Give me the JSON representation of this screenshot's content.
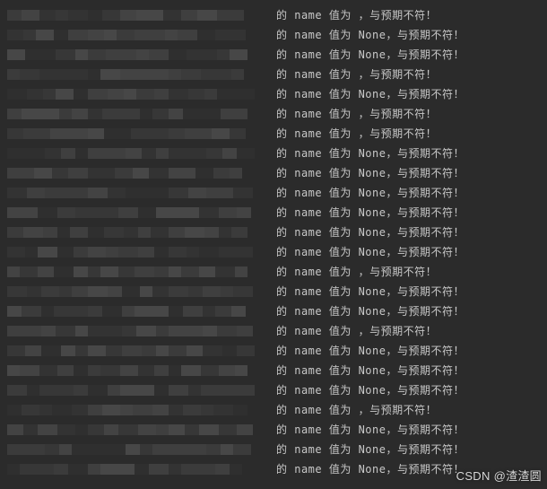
{
  "console": {
    "lines": [
      {
        "redacted_pattern": [
          38,
          42,
          40,
          36,
          44,
          38,
          42,
          40,
          36,
          38,
          42,
          40,
          44,
          36,
          38
        ],
        "field": "name",
        "value": "",
        "suffix_lang": "cn"
      },
      {
        "redacted_pattern": [
          40,
          36,
          42,
          38,
          44,
          40,
          36,
          42,
          38,
          40,
          36,
          44,
          42,
          38,
          40
        ],
        "field": "name",
        "value": "None",
        "suffix_lang": "cn"
      },
      {
        "redacted_pattern": [
          42,
          38,
          40,
          44,
          36,
          42,
          38,
          40,
          36,
          44,
          42,
          38,
          40,
          36,
          42
        ],
        "field": "name",
        "value": "None",
        "suffix_lang": "cn"
      },
      {
        "redacted_pattern": [
          36,
          44,
          38,
          40,
          42,
          36,
          44,
          38,
          40,
          42,
          36,
          44,
          38,
          40,
          36
        ],
        "field": "name",
        "value": "",
        "suffix_lang": "cn"
      },
      {
        "redacted_pattern": [
          44,
          40,
          36,
          42,
          38,
          44,
          40,
          36,
          42,
          38,
          44,
          40,
          36,
          42,
          44
        ],
        "field": "name",
        "value": "None",
        "suffix_lang": "cn"
      },
      {
        "redacted_pattern": [
          38,
          42,
          44,
          36,
          40,
          38,
          42,
          44,
          36,
          40,
          38,
          42,
          44,
          36,
          38
        ],
        "field": "name",
        "value": "",
        "suffix_lang": "cn"
      },
      {
        "redacted_pattern": [
          40,
          36,
          38,
          42,
          44,
          40,
          36,
          38,
          42,
          44,
          40,
          36,
          38,
          42,
          40
        ],
        "field": "name",
        "value": "",
        "suffix_lang": "cn"
      },
      {
        "redacted_pattern": [
          42,
          44,
          40,
          38,
          36,
          42,
          44,
          40,
          38,
          36,
          42,
          44,
          40,
          38,
          42
        ],
        "field": "name",
        "value": "None",
        "suffix_lang": "cn"
      },
      {
        "redacted_pattern": [
          36,
          38,
          42,
          40,
          44,
          36,
          38,
          42,
          40,
          44,
          36,
          38,
          42,
          40,
          36
        ],
        "field": "name",
        "value": "None",
        "suffix_lang": "cn"
      },
      {
        "redacted_pattern": [
          44,
          42,
          36,
          38,
          40,
          44,
          42,
          36,
          38,
          40,
          44,
          42,
          36,
          38,
          44
        ],
        "field": "name",
        "value": "None",
        "suffix_lang": "cn"
      },
      {
        "redacted_pattern": [
          38,
          40,
          44,
          42,
          36,
          38,
          40,
          44,
          42,
          36,
          38,
          40,
          44,
          42,
          38
        ],
        "field": "name",
        "value": "None",
        "suffix_lang": "cn"
      },
      {
        "redacted_pattern": [
          40,
          44,
          38,
          36,
          42,
          40,
          44,
          38,
          36,
          42,
          40,
          44,
          38,
          36,
          40
        ],
        "field": "name",
        "value": "None",
        "suffix_lang": "cn"
      },
      {
        "redacted_pattern": [
          42,
          36,
          44,
          40,
          38,
          42,
          36,
          44,
          40,
          38,
          42,
          36,
          44,
          40,
          42
        ],
        "field": "name",
        "value": "None",
        "suffix_lang": "cn"
      },
      {
        "redacted_pattern": [
          36,
          42,
          40,
          44,
          38,
          36,
          42,
          40,
          44,
          38,
          36,
          42,
          40,
          44,
          36
        ],
        "field": "name",
        "value": "",
        "suffix_lang": "cn"
      },
      {
        "redacted_pattern": [
          44,
          38,
          42,
          36,
          40,
          44,
          38,
          42,
          36,
          40,
          44,
          38,
          42,
          36,
          44
        ],
        "field": "name",
        "value": "None",
        "suffix_lang": "cn"
      },
      {
        "redacted_pattern": [
          38,
          44,
          36,
          40,
          42,
          38,
          44,
          36,
          40,
          42,
          38,
          44,
          36,
          40,
          38
        ],
        "field": "name",
        "value": "None",
        "suffix_lang": "cn"
      },
      {
        "redacted_pattern": [
          40,
          42,
          38,
          44,
          36,
          40,
          42,
          38,
          44,
          36,
          40,
          42,
          38,
          44,
          40
        ],
        "field": "name",
        "value": "",
        "suffix_lang": "cn"
      },
      {
        "redacted_pattern": [
          42,
          40,
          44,
          38,
          36,
          42,
          40,
          44,
          38,
          36,
          42,
          40,
          44,
          38,
          42
        ],
        "field": "name",
        "value": "None",
        "suffix_lang": "cn"
      },
      {
        "redacted_pattern": [
          36,
          44,
          42,
          40,
          38,
          36,
          44,
          42,
          40,
          38,
          36,
          44,
          42,
          40,
          36
        ],
        "field": "name",
        "value": "None",
        "suffix_lang": "cn"
      },
      {
        "redacted_pattern": [
          44,
          36,
          40,
          42,
          38,
          44,
          36,
          40,
          42,
          38,
          44,
          36,
          40,
          42,
          44
        ],
        "field": "name",
        "value": "None",
        "suffix_lang": "cn"
      },
      {
        "redacted_pattern": [
          38,
          42,
          36,
          44,
          40,
          38,
          42,
          36,
          44,
          40,
          38,
          42,
          36,
          44,
          38
        ],
        "field": "name",
        "value": "",
        "suffix_lang": "cn"
      },
      {
        "redacted_pattern": [
          40,
          38,
          44,
          42,
          36,
          40,
          38,
          44,
          42,
          36,
          40,
          38,
          44,
          42,
          40
        ],
        "field": "name",
        "value": "None",
        "suffix_lang": "cn"
      },
      {
        "redacted_pattern": [
          42,
          44,
          38,
          36,
          40,
          42,
          44,
          38,
          36,
          40,
          42,
          44,
          38,
          36,
          42
        ],
        "field": "name",
        "value": "None",
        "suffix_lang": "cn"
      },
      {
        "redacted_pattern": [
          36,
          40,
          42,
          38,
          44,
          36,
          40,
          42,
          38,
          44,
          36,
          40,
          42,
          38,
          36
        ],
        "field": "name",
        "value": "None",
        "suffix_lang": "cn"
      }
    ],
    "text": {
      "prefix": "的 ",
      "mid": " 值为 ",
      "suffix_empty": "，与预期不符！",
      "suffix_value": "，与预期不符！"
    }
  },
  "watermark": {
    "text": "CSDN @渣渣圆"
  },
  "colors": {
    "bg": "#2b2b2b",
    "text": "#c8c8c8",
    "shades": [
      "#2f2f2f",
      "#333333",
      "#373737",
      "#3b3b3b",
      "#3f3f3f",
      "#434343",
      "#474747"
    ]
  }
}
